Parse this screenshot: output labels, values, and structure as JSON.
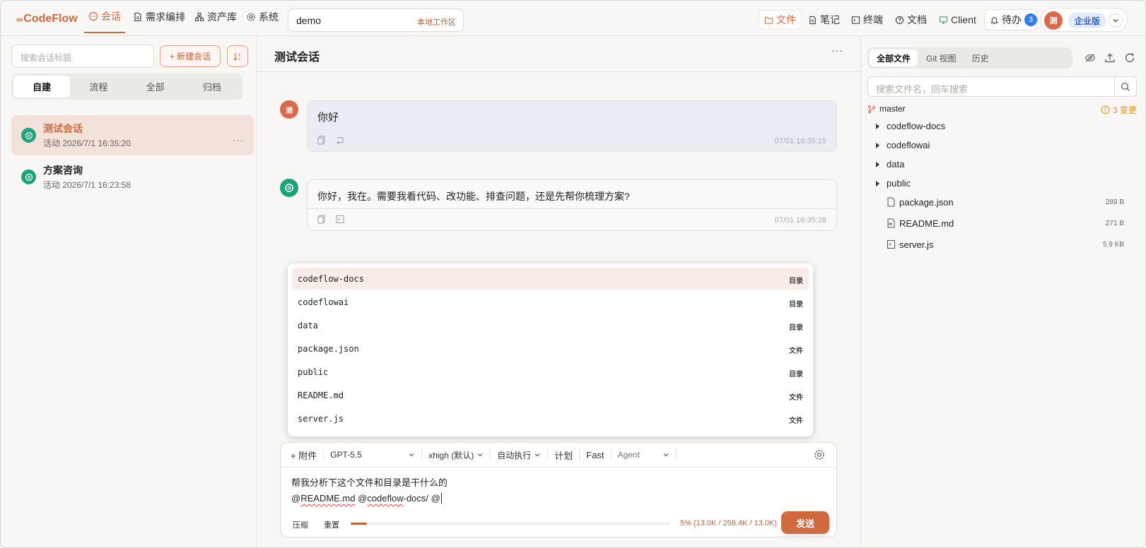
{
  "header": {
    "logo": "CodeFlow",
    "nav": [
      {
        "label": "会话",
        "icon": "chat-icon",
        "active": true
      },
      {
        "label": "需求编排",
        "icon": "document-icon",
        "active": false
      },
      {
        "label": "资产库",
        "icon": "hierarchy-icon",
        "active": false
      },
      {
        "label": "系统",
        "icon": "gear-icon",
        "active": false
      }
    ],
    "workspace": {
      "name": "demo",
      "badge": "本地工作区"
    },
    "right_tabs": [
      {
        "label": "文件",
        "icon": "folder-icon",
        "active": true
      },
      {
        "label": "笔记",
        "icon": "note-icon",
        "active": false
      },
      {
        "label": "终端",
        "icon": "terminal-icon",
        "active": false
      },
      {
        "label": "文档",
        "icon": "help-icon",
        "active": false
      },
      {
        "label": "Client",
        "icon": "monitor-icon",
        "active": false
      }
    ],
    "todo": {
      "label": "待办",
      "count": "3"
    },
    "account": {
      "avatar": "测",
      "plan": "企业版"
    }
  },
  "sidebar": {
    "search_placeholder": "搜索会话标题",
    "new_button": "+ 新建会话",
    "filters": [
      "自建",
      "流程",
      "全部",
      "归档"
    ],
    "active_filter": "自建",
    "conversations": [
      {
        "title": "测试会话",
        "time": "活动 2026/7/1 16:35:20",
        "selected": true,
        "more": "···"
      },
      {
        "title": "方案咨询",
        "time": "活动 2026/7/1 16:23:58",
        "selected": false
      }
    ]
  },
  "chat": {
    "title": "测试会话",
    "more": "···",
    "messages": [
      {
        "role": "user",
        "avatar": "测",
        "text": "你好",
        "time": "07/01 16:35:15"
      },
      {
        "role": "assistant",
        "text": "你好，我在。需要我看代码、改功能、排查问题，还是先帮你梳理方案?",
        "time": "07/01 16:35:28"
      }
    ],
    "mention_dropdown": [
      {
        "name": "codeflow-docs",
        "kind": "目录",
        "highlighted": true
      },
      {
        "name": "codeflowai",
        "kind": "目录"
      },
      {
        "name": "data",
        "kind": "目录"
      },
      {
        "name": "package.json",
        "kind": "文件"
      },
      {
        "name": "public",
        "kind": "目录"
      },
      {
        "name": "README.md",
        "kind": "文件"
      },
      {
        "name": "server.js",
        "kind": "文件"
      }
    ],
    "composer": {
      "attach": "+ 附件",
      "model": "GPT-5.5",
      "effort": "xhigh (默认)",
      "exec": "自动执行",
      "plan": "计划",
      "fast": "Fast",
      "mode_placeholder": "Agent",
      "line1": "帮我分析下这个文件和目录是干什么的",
      "line2_parts": [
        "@",
        "README.md",
        " @",
        "codeflow",
        "-docs/ @"
      ],
      "compress": "压缩",
      "reset": "重置",
      "context_text": "5% (13.0K / 258.4K / 13.0K)",
      "context_fraction": 0.05,
      "send": "发送"
    }
  },
  "files": {
    "tabs": [
      "全部文件",
      "Git 视图",
      "历史"
    ],
    "active_tab": "全部文件",
    "search_placeholder": "搜索文件名，回车搜索",
    "branch": "master",
    "changes": "3 变更",
    "tree": [
      {
        "name": "codeflow-docs",
        "type": "dir"
      },
      {
        "name": "codeflowai",
        "type": "dir"
      },
      {
        "name": "data",
        "type": "dir"
      },
      {
        "name": "public",
        "type": "dir"
      },
      {
        "name": "package.json",
        "type": "file",
        "icon": "file-icon",
        "size": "289 B"
      },
      {
        "name": "README.md",
        "type": "file",
        "icon": "markdown-file-icon",
        "size": "271 B"
      },
      {
        "name": "server.js",
        "type": "file",
        "icon": "script-file-icon",
        "size": "5.9 KB"
      }
    ]
  },
  "colors": {
    "accent": "#cf6a3f",
    "assistant": "#1ea27a",
    "badge_blue": "#2f7ee8",
    "warning": "#e0932a"
  }
}
